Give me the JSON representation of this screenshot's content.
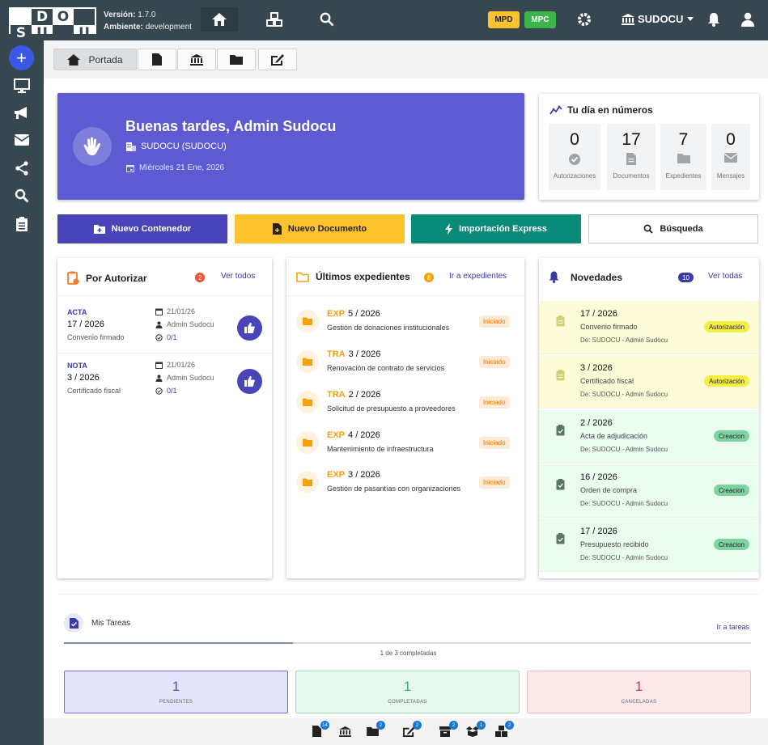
{
  "app": {
    "logo_letters": [
      "",
      "D",
      "O",
      "",
      "S",
      "U",
      "",
      "U"
    ],
    "version_label": "Versión:",
    "version_value": "1.7.0",
    "env_label": "Ambiente:",
    "env_value": "development",
    "mpd_label": "MPD",
    "mpc_label": "MPC",
    "institution": "SUDOCU"
  },
  "colors": {
    "sidebar": "#37474f",
    "hero": "#5d5ad2",
    "primary_button": "#4944b8",
    "doc_button": "#fdc22c",
    "import_button": "#0a8a78",
    "mpd_pill": "#fdc22c",
    "mpc_pill": "#3cb44b"
  },
  "tabs": [
    {
      "label": "Portada",
      "icon": "home-icon"
    },
    {
      "label": "",
      "icon": "document-icon"
    },
    {
      "label": "",
      "icon": "bank-icon"
    },
    {
      "label": "",
      "icon": "folder-icon"
    },
    {
      "label": "",
      "icon": "sign-icon"
    }
  ],
  "hero": {
    "greeting": "Buenas tardes, Admin Sudocu",
    "org": "SUDOCU  (SUDOCU)",
    "date": "Miércoles 21 Ene, 2026"
  },
  "numbers": {
    "title": "Tu día en números",
    "items": [
      {
        "value": "0",
        "label": "Autorizaciones",
        "icon": "check-badge-icon"
      },
      {
        "value": "17",
        "label": "Documentos",
        "icon": "document-icon"
      },
      {
        "value": "7",
        "label": "Expedientes",
        "icon": "folder-icon"
      },
      {
        "value": "0",
        "label": "Mensajes",
        "icon": "mail-icon"
      }
    ]
  },
  "actions": {
    "new_container": "Nuevo Contenedor",
    "new_document": "Nuevo Documento",
    "express_import": "Importación Express",
    "search": "Búsqueda"
  },
  "authorize": {
    "title": "Por Autorizar",
    "count": "2",
    "link": "Ver todos",
    "items": [
      {
        "type": "ACTA",
        "number": "17 / 2026",
        "desc": "Convenio firmado",
        "date": "21/01/26",
        "user": "Admin Sudocu",
        "progress": "0/1"
      },
      {
        "type": "NOTA",
        "number": "3 / 2026",
        "desc": "Certificado fiscal",
        "date": "21/01/26",
        "user": "Admin Sudocu",
        "progress": "0/1"
      }
    ]
  },
  "files": {
    "title": "Últimos expedientes",
    "count": "8",
    "link": "Ir a expedientes",
    "items": [
      {
        "prefix": "EXP",
        "number": "5 / 2026",
        "desc": "Gestión de donaciones institucionales",
        "status": "Iniciado"
      },
      {
        "prefix": "TRA",
        "number": "3 / 2026",
        "desc": "Renovación de contrato de servicios",
        "status": "Iniciado"
      },
      {
        "prefix": "TRA",
        "number": "2 / 2026",
        "desc": "Solicitud de presupuesto a proveedores",
        "status": "Iniciado"
      },
      {
        "prefix": "EXP",
        "number": "4 / 2026",
        "desc": "Mantenimiento de infraestructura",
        "status": "Iniciado"
      },
      {
        "prefix": "EXP",
        "number": "3 / 2026",
        "desc": "Gestión de pasantías con organizaciones",
        "status": "Iniciado"
      }
    ]
  },
  "news": {
    "title": "Novedades",
    "count": "10",
    "link": "Ver todas",
    "items": [
      {
        "number": "17 / 2026",
        "desc": "Convenio firmado",
        "from": "De: SUDOCU - Admin Sudocu",
        "tag": "Autorización",
        "kind": "aut"
      },
      {
        "number": "3 / 2026",
        "desc": "Certificado fiscal",
        "from": "De: SUDOCU - Admin Sudocu",
        "tag": "Autorización",
        "kind": "aut"
      },
      {
        "number": "2 / 2026",
        "desc": "Acta de adjudicación",
        "from": "De: SUDOCU - Admin Sudocu",
        "tag": "Creacion",
        "kind": "cre"
      },
      {
        "number": "16 / 2026",
        "desc": "Orden de compra",
        "from": "De: SUDOCU - Admin Sudocu",
        "tag": "Creacion",
        "kind": "cre"
      },
      {
        "number": "17 / 2026",
        "desc": "Presupuesto recibido",
        "from": "De: SUDOCU - Admin Sudocu",
        "tag": "Creacion",
        "kind": "cre"
      }
    ]
  },
  "tasks": {
    "title": "Mis Tareas",
    "link": "Ir a tareas",
    "completed_fraction": 0.333,
    "summary": "1 de 3 completadas",
    "pending_value": "1",
    "pending_label": "PENDIENTES",
    "done_value": "1",
    "done_label": "COMPLETADAS",
    "cancel_value": "1",
    "cancel_label": "CANCELADAS"
  },
  "bottom": [
    {
      "icon": "document-icon",
      "badge": "14"
    },
    {
      "icon": "bank-icon",
      "badge": ""
    },
    {
      "icon": "folder-icon",
      "badge": "2"
    },
    {
      "icon": "sign-icon",
      "badge": "2"
    },
    {
      "icon": "archive-icon",
      "badge": "2"
    },
    {
      "icon": "box-open-icon",
      "badge": "1"
    },
    {
      "icon": "boxes-icon",
      "badge": "2"
    }
  ]
}
